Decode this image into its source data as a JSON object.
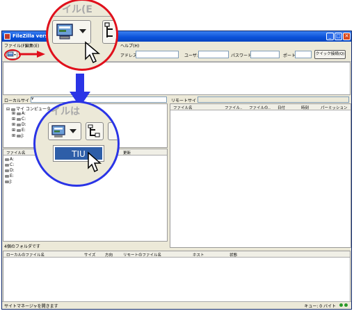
{
  "window": {
    "title": "FileZilla version",
    "minimize": "_",
    "maximize": "□",
    "close": "✕"
  },
  "menu": {
    "file": "ファイル(F)",
    "edit": "編集(E)",
    "help": "ヘルプ(H)"
  },
  "toolbar": {
    "address_label": "アドレス:",
    "user_label": "ユーザ:",
    "password_label": "パスワード:",
    "port_label": "ポート:",
    "quickconnect_label": "クイック接続(Q)",
    "address_value": "",
    "user_value": "",
    "password_value": "",
    "port_value": ""
  },
  "local": {
    "site_label": "ローカルサイト:",
    "path_value": "¥",
    "tree_root": "マイ コンピュータ",
    "drives": [
      "A:",
      "C:",
      "D:",
      "E:",
      "J:"
    ],
    "columns": [
      "ファイル名",
      "更新"
    ],
    "files": [
      "A:",
      "C:",
      "D:",
      "E:",
      "J:"
    ],
    "status": "4個のフォルダです"
  },
  "remote": {
    "site_label": "リモートサイト:",
    "columns": [
      "ファイル名",
      "ファイル..",
      "ファイルの..",
      "日付",
      "時刻",
      "パーミッション"
    ]
  },
  "queue": {
    "columns": [
      "ローカルのファイル名",
      "サイズ",
      "方向",
      "リモートのファイル名",
      "ホスト",
      "状態"
    ]
  },
  "statusbar": {
    "left": "サイトマネージャを開きます",
    "right": "キュー: 0 バイト"
  },
  "zoom": {
    "ghost_text": "イル(E",
    "ghost_text_lower": "イルは",
    "menu_item": "TIU",
    "annotation_colors": {
      "top_circle": "#e0101c",
      "arrow": "#2a34e6",
      "bottom_circle": "#2a34e6"
    }
  }
}
